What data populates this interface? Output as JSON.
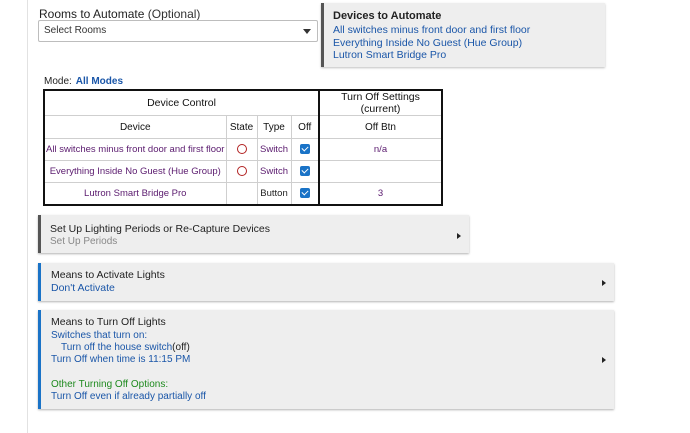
{
  "rooms": {
    "label": "Rooms to Automate",
    "optional": "(Optional)",
    "placeholder": "Select Rooms"
  },
  "devices_box": {
    "title": "Devices to Automate",
    "items": [
      "All switches minus front door and first floor",
      "Everything Inside No Guest (Hue Group)",
      "Lutron Smart Bridge Pro"
    ]
  },
  "mode": {
    "label": "Mode:",
    "value": "All Modes"
  },
  "table": {
    "group_headers": {
      "device_control": "Device Control",
      "turn_off": "Turn Off Settings (current)"
    },
    "columns": [
      "Device",
      "State",
      "Type",
      "Off",
      "Off Btn"
    ],
    "rows": [
      {
        "device": "All switches minus front door and first floor",
        "state_icon": "radio-off-icon",
        "type": "Switch",
        "off": true,
        "off_btn": "n/a"
      },
      {
        "device": "Everything Inside No Guest (Hue Group)",
        "state_icon": "radio-off-icon",
        "type": "Switch",
        "off": true,
        "off_btn": ""
      },
      {
        "device": "Lutron Smart Bridge Pro",
        "state_icon": "",
        "type": "Button",
        "off": true,
        "off_btn": "3"
      }
    ]
  },
  "panels": {
    "lighting_periods": {
      "title": "Set Up Lighting Periods or Re-Capture Devices",
      "subtitle": "Set Up Periods"
    },
    "activate": {
      "title": "Means to Activate Lights",
      "subtitle": "Don't Activate"
    },
    "turn_off": {
      "title": "Means to Turn Off Lights",
      "switches_label": "Switches that turn on:",
      "switch_line": "Turn off the house switch",
      "switch_state": "(off)",
      "time_line": "Turn Off when time is 11:15 PM",
      "other_label": "Other Turning Off Options:",
      "other_value": "Turn Off even if already partially off"
    }
  },
  "colors": {
    "link_blue": "#1a56a8",
    "device_purple": "#5a1a6e",
    "accent_blue": "#1a73c7",
    "option_green": "#1e8a1e",
    "radio_red": "#b22222"
  }
}
